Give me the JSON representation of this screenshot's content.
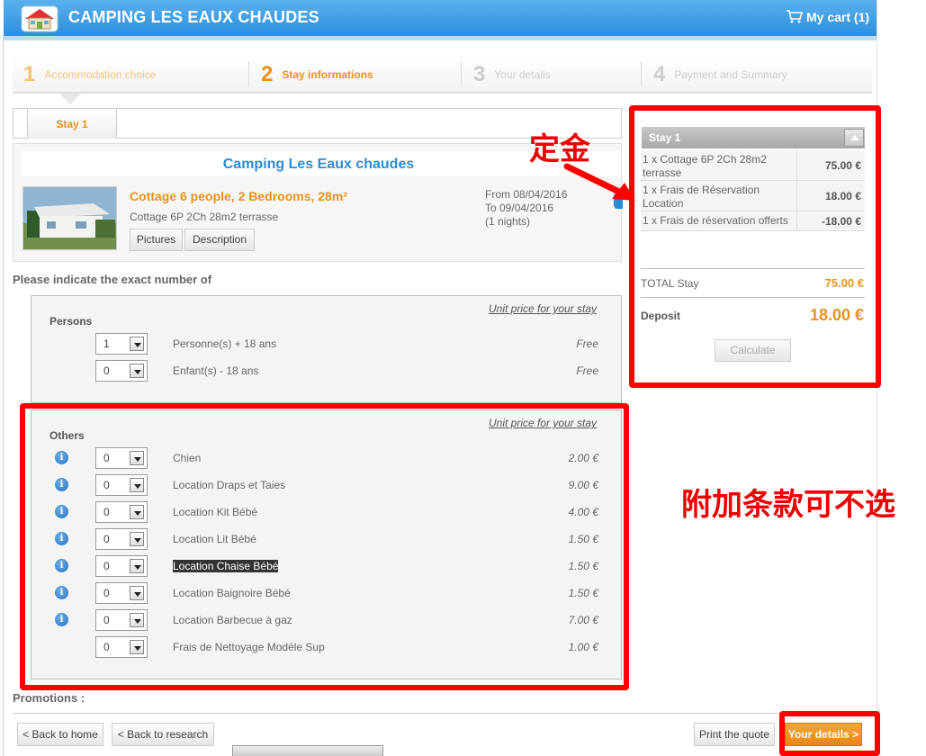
{
  "header": {
    "title": "CAMPING LES EAUX CHAUDES",
    "cart_label": "My cart (1)"
  },
  "steps": [
    {
      "num": "1",
      "label": "Accommodation choice",
      "state": "done"
    },
    {
      "num": "2",
      "label": "Stay informations",
      "state": "active"
    },
    {
      "num": "3",
      "label": "Your details",
      "state": "todo"
    },
    {
      "num": "4",
      "label": "Payment and Summary",
      "state": "todo"
    }
  ],
  "stay": {
    "tab_label": "Stay 1",
    "camping_name": "Camping Les Eaux chaudes",
    "accommodation_title": "Cottage 6 people, 2 Bedrooms, 28m²",
    "accommodation_sub": "Cottage 6P 2Ch 28m2 terrasse",
    "pictures_label": "Pictures",
    "description_label": "Description",
    "date_from": "From 08/04/2016",
    "date_to": "To 09/04/2016",
    "nights": "(1 nights)"
  },
  "indicate_label": "Please indicate the exact number of",
  "persons": {
    "unit_label": "Unit price for your stay",
    "title": "Persons",
    "rows": [
      {
        "qty": "1",
        "label": "Personne(s) + 18 ans",
        "price": "Free"
      },
      {
        "qty": "0",
        "label": "Enfant(s) - 18 ans",
        "price": "Free"
      }
    ]
  },
  "others": {
    "unit_label": "Unit price for your stay",
    "title": "Others",
    "rows": [
      {
        "qty": "0",
        "label": "Chien",
        "price": "2.00 €",
        "info": true
      },
      {
        "qty": "0",
        "label": "Location Draps et Taies",
        "price": "9.00 €",
        "info": true
      },
      {
        "qty": "0",
        "label": "Location Kit Bébé",
        "price": "4.00 €",
        "info": true
      },
      {
        "qty": "0",
        "label": "Location Lit Bébé",
        "price": "1.50 €",
        "info": true
      },
      {
        "qty": "0",
        "label": "Location Chaise Bébé",
        "price": "1.50 €",
        "info": true,
        "selected": true
      },
      {
        "qty": "0",
        "label": "Location Baignoire Bébé",
        "price": "1.50 €",
        "info": true
      },
      {
        "qty": "0",
        "label": "Location Barbecue à gaz",
        "price": "7.00 €",
        "info": true
      },
      {
        "qty": "0",
        "label": "Frais de Nettoyage Modèle Sup",
        "price": "1.00 €",
        "info": false
      }
    ]
  },
  "promotions_label": "Promotions :",
  "footer": {
    "back_home": "< Back to home",
    "back_research": "< Back to research",
    "print_quote": "Print the quote",
    "your_details": "Your details >"
  },
  "summary": {
    "title": "Stay 1",
    "lines": [
      {
        "desc": "1 x Cottage 6P 2Ch 28m2 terrasse",
        "amount": "75.00 €"
      },
      {
        "desc": "1 x Frais de Réservation Location",
        "amount": "18.00 €"
      },
      {
        "desc": "1 x Frais de réservation offerts",
        "amount": "-18.00 €"
      }
    ],
    "total_label": "TOTAL Stay",
    "total_value": "75.00 €",
    "deposit_label": "Deposit",
    "deposit_value": "18.00 €",
    "calculate_label": "Calculate"
  },
  "annotations": {
    "deposit_note": "定金",
    "extras_note": "附加条款可不选"
  },
  "colors": {
    "brand_blue": "#2d8fe0",
    "accent_orange": "#e8921c",
    "annotation_red": "#ff0000"
  }
}
